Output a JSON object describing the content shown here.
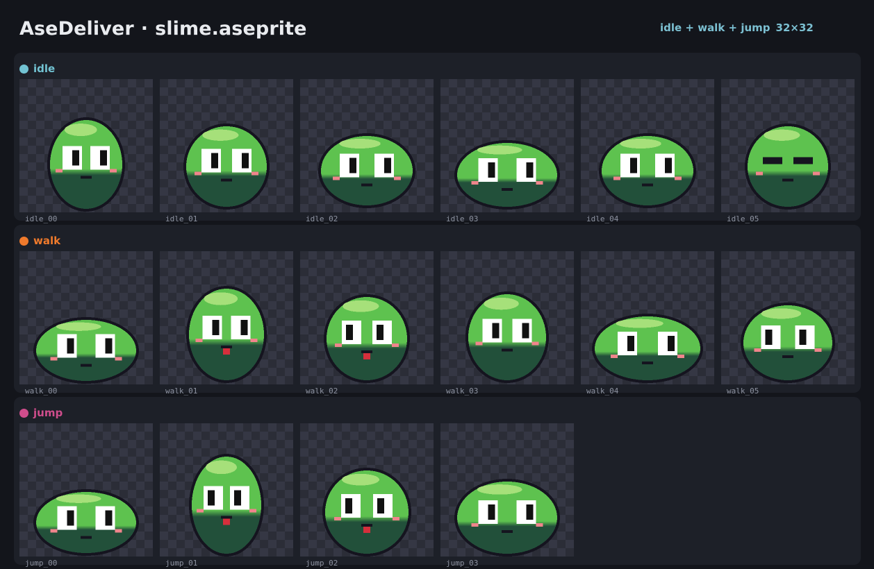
{
  "app": {
    "name": "AseDeliver",
    "separator": "·",
    "file": "slime.aseprite"
  },
  "meta": {
    "tags_summary": "idle + walk + jump",
    "frame_size": "32×32"
  },
  "animations": [
    {
      "tag": "idle",
      "color": "#72c3d3",
      "frames": [
        "idle_00",
        "idle_01",
        "idle_02",
        "idle_03",
        "idle_04",
        "idle_05"
      ]
    },
    {
      "tag": "walk",
      "color": "#ef7a2c",
      "frames": [
        "walk_00",
        "walk_01",
        "walk_02",
        "walk_03",
        "walk_04",
        "walk_05"
      ]
    },
    {
      "tag": "jump",
      "color": "#cf4d8c",
      "frames": [
        "jump_00",
        "jump_01",
        "jump_02",
        "jump_03"
      ]
    }
  ],
  "palette": {
    "outline": "#15141f",
    "body_top": "#5ec24f",
    "body_bottom": "#22503a",
    "highlight": "#a6e07a",
    "eye_white": "#ffffff",
    "pupil": "#111111",
    "cheek": "#f0858c",
    "tongue": "#d62f3c"
  }
}
